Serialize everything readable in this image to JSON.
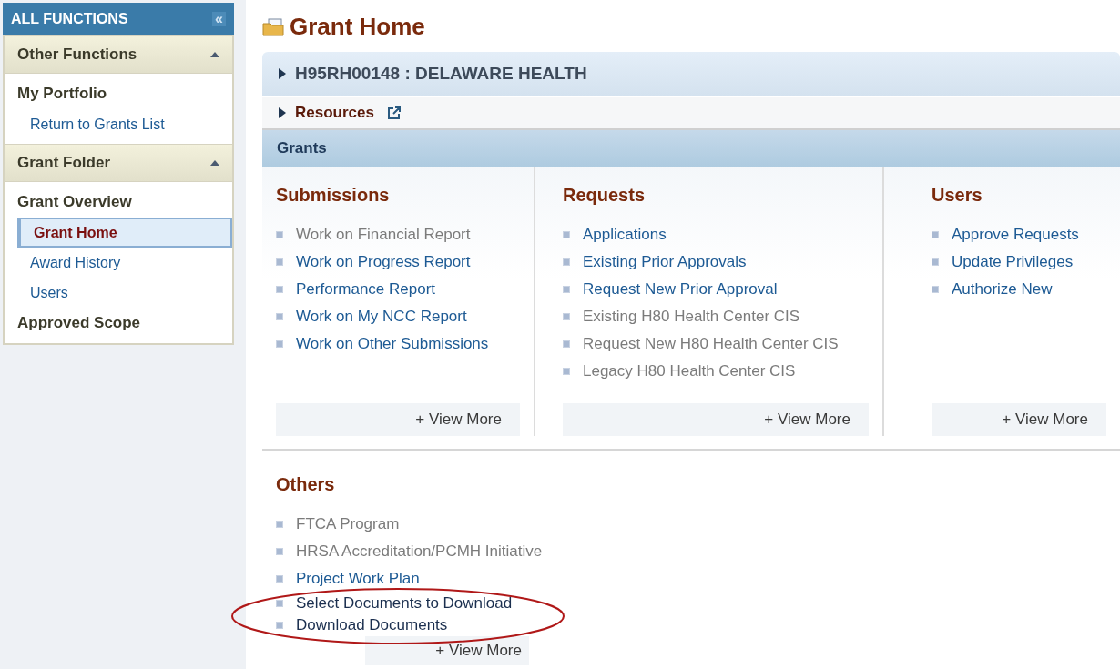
{
  "sidebar": {
    "title": "ALL FUNCTIONS",
    "collapse_glyph": "«",
    "sections": [
      {
        "title": "Other Functions",
        "expanded": true,
        "items": [
          {
            "label": "My Portfolio",
            "kind": "heading",
            "selected": false
          },
          {
            "label": "Return to Grants List",
            "kind": "link",
            "selected": false
          }
        ]
      },
      {
        "title": "Grant Folder",
        "expanded": true,
        "items": [
          {
            "label": "Grant Overview",
            "kind": "heading",
            "selected": false
          },
          {
            "label": "Grant Home",
            "kind": "link",
            "selected": true
          },
          {
            "label": "Award History",
            "kind": "link",
            "selected": false
          },
          {
            "label": "Users",
            "kind": "link",
            "selected": false
          },
          {
            "label": "Approved Scope",
            "kind": "heading",
            "selected": false
          }
        ]
      }
    ]
  },
  "page": {
    "title": "Grant Home",
    "grant_bar": {
      "label": "H95RH00148 : DELAWARE HEALTH",
      "expanded": false
    },
    "resources": {
      "label": "Resources",
      "expanded": false
    },
    "grants_header": "Grants",
    "columns": [
      {
        "title": "Submissions",
        "view_more": "+ View More",
        "links": [
          {
            "label": "Work on Financial Report",
            "disabled": true
          },
          {
            "label": "Work on Progress Report",
            "disabled": false
          },
          {
            "label": "Performance Report",
            "disabled": false
          },
          {
            "label": "Work on My NCC Report",
            "disabled": false
          },
          {
            "label": "Work on Other Submissions",
            "disabled": false
          }
        ]
      },
      {
        "title": "Requests",
        "view_more": "+ View More",
        "links": [
          {
            "label": "Applications",
            "disabled": false
          },
          {
            "label": "Existing Prior Approvals",
            "disabled": false
          },
          {
            "label": "Request New Prior Approval",
            "disabled": false
          },
          {
            "label": "Existing H80 Health Center CIS",
            "disabled": true
          },
          {
            "label": "Request New H80 Health Center CIS",
            "disabled": true
          },
          {
            "label": "Legacy H80 Health Center CIS",
            "disabled": true
          }
        ]
      },
      {
        "title": "Users",
        "view_more": "+ View More",
        "links": [
          {
            "label": "Approve Requests",
            "disabled": false
          },
          {
            "label": "Update Privileges",
            "disabled": false
          },
          {
            "label": "Authorize New",
            "disabled": false
          }
        ]
      }
    ],
    "others": {
      "title": "Others",
      "view_more": "+ View More",
      "links": [
        {
          "label": "FTCA Program",
          "disabled": true,
          "highlighted": false
        },
        {
          "label": "HRSA Accreditation/PCMH Initiative",
          "disabled": true,
          "highlighted": false
        },
        {
          "label": "Project Work Plan",
          "disabled": false,
          "highlighted": false
        },
        {
          "label": "Select Documents to Download",
          "disabled": false,
          "highlighted": true
        },
        {
          "label": "Download Documents",
          "disabled": false,
          "highlighted": true
        }
      ]
    }
  }
}
